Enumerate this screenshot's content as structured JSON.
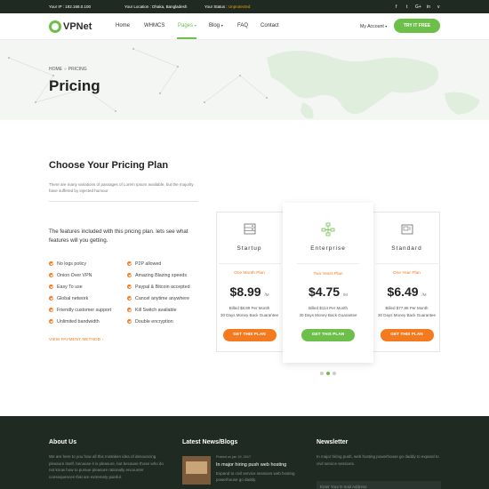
{
  "topbar": {
    "ip_label": "Your IP : ",
    "ip_value": "192.168.0.100",
    "location_label": "Your Location : ",
    "location_value": "Dhaka, Bangladesh",
    "status_label": "Your Status : ",
    "status_value": "Unprotected",
    "social": [
      "f",
      "t",
      "G+",
      "in",
      "v"
    ]
  },
  "header": {
    "logo": "VPNet",
    "nav": [
      "Home",
      "WHMCS",
      "Pages",
      "Blog",
      "FAQ",
      "Contact"
    ],
    "account": "My Account",
    "try_button": "TRY IT FREE"
  },
  "hero": {
    "breadcrumb_home": "HOME",
    "breadcrumb_sep": "»",
    "breadcrumb_current": "PRICING",
    "title": "Pricing"
  },
  "section": {
    "title": "Choose Your Pricing Plan",
    "description": "There are many variations of passages of Lorem Ipsum available, but the majority have suffered by injected humour",
    "features_intro": "The features included with this pricing plan. lets see what features will you getting.",
    "features_left": [
      "No logs policy",
      "Onion Over VPN",
      "Easy To use",
      "Global network",
      "Friendly customer support",
      "Unlimited bandwidth"
    ],
    "features_right": [
      "P2P allowed",
      "Amazing Blazing speeds",
      "Paypal & Bitcoin accepted",
      "Cancel anytime anywhere",
      "Kill Switch available",
      "Double encryption"
    ],
    "view_payment": "VIEW PAYMENT METHOD"
  },
  "plans": [
    {
      "name": "Startup",
      "period": "One Month Plan",
      "price": "$8.99",
      "unit": "/M",
      "billed": "Billed $8.99 Per Month",
      "guarantee": "30 Days Money Back Guarantee",
      "button": "GET THIS PLAN",
      "icon": "server-icon",
      "button_color": "#f47a1f"
    },
    {
      "name": "Enterprise",
      "period": "Two Years Plan",
      "price": "$4.75",
      "unit": "/M",
      "billed": "Billed $114 Per Month",
      "guarantee": "30 Days Money Back Guarantee",
      "button": "GET THIS PLAN",
      "icon": "network-icon",
      "button_color": "#6cc04a"
    },
    {
      "name": "Standard",
      "period": "One Year Plan",
      "price": "$6.49",
      "unit": "/M",
      "billed": "Billed $77.88 Per Month",
      "guarantee": "30 Days Money Back Guarantee",
      "button": "GET THIS PLAN",
      "icon": "storage-icon",
      "button_color": "#f47a1f"
    }
  ],
  "footer": {
    "about_title": "About Us",
    "about_text": "We are here to you how all this mistaken idea of denouncing pleasure itself, because it is pleasure, but because those who do not know how to pursue pleasure rationally encounter consequences that are extremely painful.",
    "news_title": "Latest News/Blogs",
    "news_date": "Posted on jan 19, 2017",
    "news_item_title": "In major hiring push web hosting",
    "news_item_body": "Expand to civil service sessions web hosting powerhouse go daddy.",
    "newsletter_title": "Newsletter",
    "newsletter_text": "In major hiring push, web hosting powerhouse go daddy to expand to civil service sessions.",
    "newsletter_placeholder": "Enter Your E-mail Address"
  },
  "colors": {
    "green": "#6cc04a",
    "orange": "#f47a1f",
    "dark": "#1f2a23"
  }
}
